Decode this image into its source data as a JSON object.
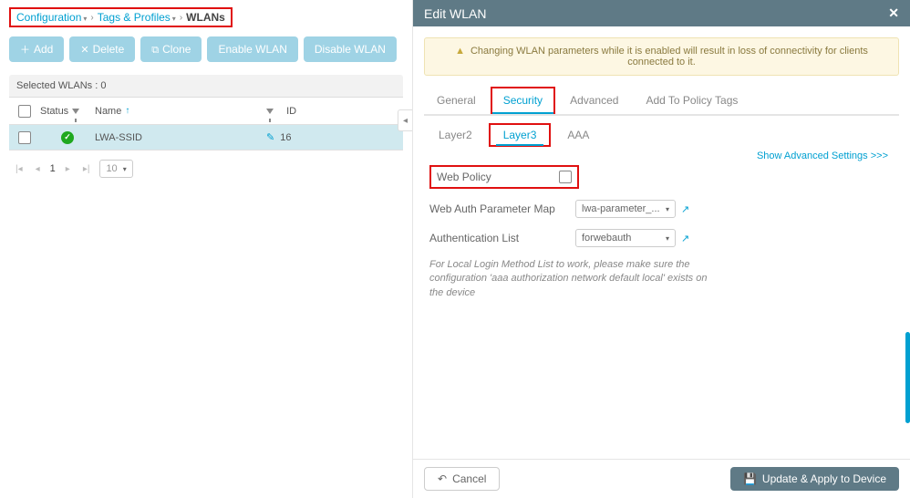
{
  "breadcrumb": {
    "root": "Configuration",
    "mid": "Tags & Profiles",
    "current": "WLANs"
  },
  "toolbar": {
    "add": "Add",
    "delete": "Delete",
    "clone": "Clone",
    "enable": "Enable WLAN",
    "disable": "Disable WLAN"
  },
  "selected_bar": "Selected WLANs : 0",
  "columns": {
    "status": "Status",
    "name": "Name",
    "id": "ID"
  },
  "rows": [
    {
      "name": "LWA-SSID",
      "id": "16"
    }
  ],
  "pagination": {
    "current": "1",
    "page_size": "10"
  },
  "panel": {
    "title": "Edit WLAN",
    "warning": "Changing WLAN parameters while it is enabled will result in loss of connectivity for clients connected to it.",
    "tabs": {
      "general": "General",
      "security": "Security",
      "advanced": "Advanced",
      "add_to_policy": "Add To Policy Tags"
    },
    "subtabs": {
      "layer2": "Layer2",
      "layer3": "Layer3",
      "aaa": "AAA"
    },
    "advanced_link": "Show Advanced Settings >>>",
    "form": {
      "web_policy_label": "Web Policy",
      "web_auth_param_label": "Web Auth Parameter Map",
      "web_auth_param_value": "lwa-parameter_...",
      "auth_list_label": "Authentication List",
      "auth_list_value": "forwebauth",
      "note": "For Local Login Method List to work, please make sure the configuration 'aaa authorization network default local' exists on the device"
    },
    "footer": {
      "cancel": "Cancel",
      "apply": "Update & Apply to Device"
    }
  }
}
